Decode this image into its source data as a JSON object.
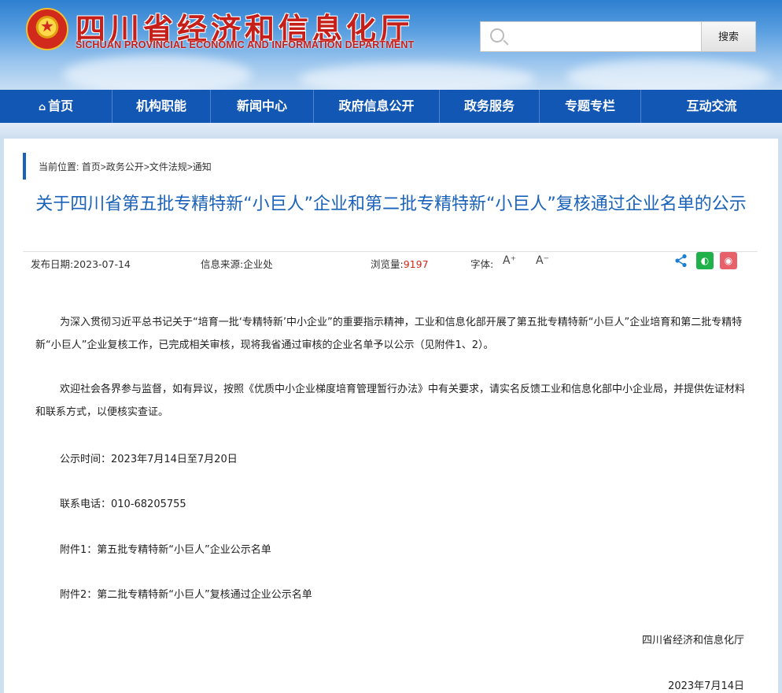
{
  "header": {
    "title": "四川省经济和信息化厅",
    "subtitle": "SICHUAN PROVINCIAL ECONOMIC AND INFORMATION DEPARTMENT",
    "search_placeholder": "",
    "search_button": "搜索"
  },
  "nav": {
    "items": [
      "首页",
      "机构职能",
      "新闻中心",
      "政府信息公开",
      "政务服务",
      "专题专栏",
      "互动交流"
    ]
  },
  "breadcrumb": {
    "prefix": "当前位置:",
    "path": "首页>政务公开>文件法规>通知"
  },
  "article": {
    "title": "关于四川省第五批专精特新“小巨人”企业和第二批专精特新“小巨人”复核通过企业名单的公示",
    "meta": {
      "date_label": "发布日期:2023-07-14",
      "source_label": "信息来源:",
      "source": "企业处",
      "views_label": "浏览量:",
      "views": "9197",
      "font_label": "字体:",
      "font_up": "A⁺",
      "font_down": "A⁻"
    },
    "paragraphs": [
      "为深入贯彻习近平总书记关于“培育一批‘专精特新’中小企业”的重要指示精神，工业和信息化部开展了第五批专精特新“小巨人”企业培育和第二批专精特新“小巨人”企业复核工作，已完成相关审核，现将我省通过审核的企业名单予以公示（见附件1、2）。",
      "欢迎社会各界参与监督，如有异议，按照《优质中小企业梯度培育管理暂行办法》中有关要求，请实名反馈工业和信息化部中小企业局，并提供佐证材料和联系方式，以便核实查证。"
    ],
    "notice_time": "公示时间：2023年7月14日至7月20日",
    "contact_phone": "联系电话：010-68205755",
    "attachment_1": "附件1：第五批专精特新“小巨人”企业公示名单",
    "attachment_2": "附件2：第二批专精特新“小巨人”复核通过企业公示名单",
    "signature_org": "四川省经济和信息化厅",
    "signature_date": "2023年7月14日"
  },
  "colors": {
    "nav_bg": "#1257b4",
    "title_color": "#1a62b9",
    "views_color": "#d12a1c",
    "brand_red": "#c61f1a"
  },
  "icons": {
    "emblem": "national-emblem",
    "search": "search-icon",
    "home": "home-icon",
    "share": "share-icon",
    "wechat": "wechat-icon",
    "weibo": "weibo-icon"
  }
}
